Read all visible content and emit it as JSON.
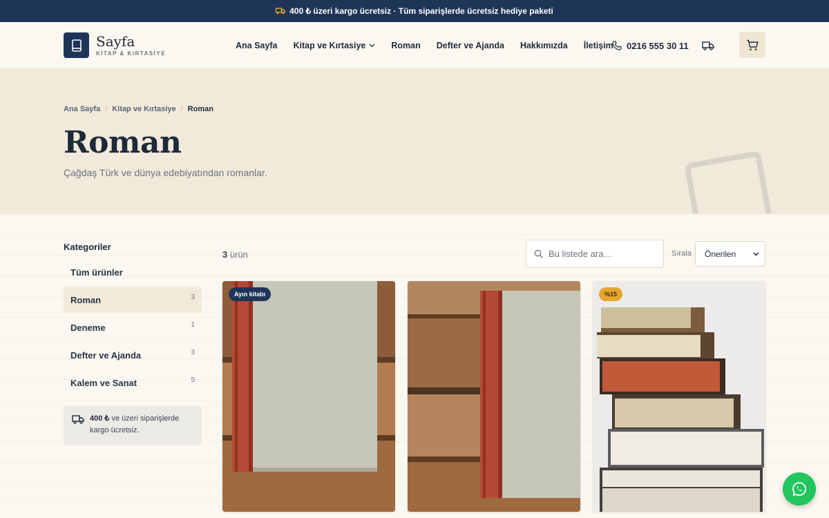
{
  "announcement": {
    "text": "400 ₺ üzeri kargo ücretsiz · Tüm siparişlerde ücretsiz hediye paketi",
    "icon": "truck-icon"
  },
  "header": {
    "logo_name": "Sayfa",
    "logo_sub": "KİTAP & KIRTASİYE",
    "nav": [
      {
        "label": "Ana Sayfa"
      },
      {
        "label": "Kitap ve Kırtasiye",
        "has_dropdown": true
      },
      {
        "label": "Roman"
      },
      {
        "label": "Defter ve Ajanda"
      },
      {
        "label": "Hakkımızda"
      },
      {
        "label": "İletişim"
      }
    ],
    "phone": "0216 555 30 11"
  },
  "hero": {
    "breadcrumb": [
      "Ana Sayfa",
      "Kitap ve Kırtasiye",
      "Roman"
    ],
    "title": "Roman",
    "subtitle": "Çağdaş Türk ve dünya edebiyatından romanlar."
  },
  "sidebar": {
    "heading": "Kategoriler",
    "categories": [
      {
        "label": "Tüm ürünler",
        "count": ""
      },
      {
        "label": "Roman",
        "count": "3",
        "active": true
      },
      {
        "label": "Deneme",
        "count": "1"
      },
      {
        "label": "Defter ve Ajanda",
        "count": "3"
      },
      {
        "label": "Kalem ve Sanat",
        "count": "5"
      }
    ],
    "shipping_bold": "400 ₺",
    "shipping_text": " ve üzeri siparişlerde kargo ücretsiz."
  },
  "listing": {
    "count": "3",
    "count_suffix": " ürün",
    "search_placeholder": "Bu listede ara…",
    "sort_label": "Sırala",
    "sort_value": "Önerilen"
  },
  "products": [
    {
      "badge": "Ayın kitabı"
    },
    {
      "badge": ""
    },
    {
      "badge": "%15"
    }
  ],
  "colors": {
    "navy": "#1f3558",
    "cream": "#f1eadb",
    "gold": "#e5a72d",
    "whatsapp": "#22c55e"
  }
}
